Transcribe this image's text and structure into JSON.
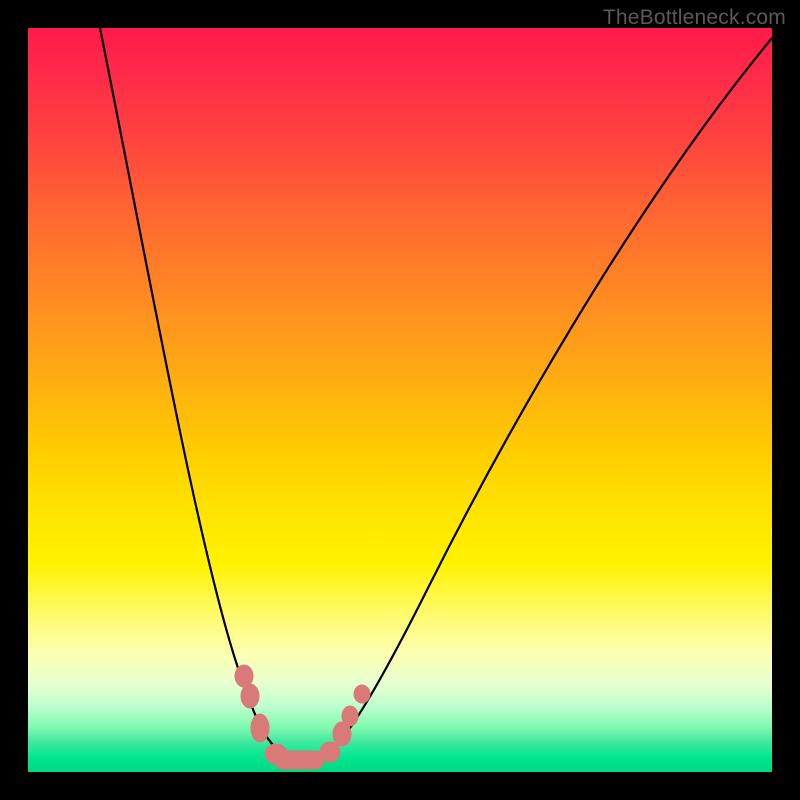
{
  "watermark": "TheBottleneck.com",
  "chart_data": {
    "type": "line",
    "title": "",
    "xlabel": "",
    "ylabel": "",
    "x_range": [
      0,
      100
    ],
    "y_range_percent_bottleneck": [
      0,
      100
    ],
    "background_gradient_meaning": "red (top) = high bottleneck, green (bottom) = no bottleneck",
    "series": [
      {
        "name": "bottleneck-curve",
        "description": "V-shaped curve; minimum near x≈36 where bottleneck ≈ 0%",
        "x": [
          10,
          15,
          20,
          25,
          28,
          31,
          33,
          35,
          37,
          39,
          41,
          44,
          50,
          60,
          75,
          95,
          100
        ],
        "y_percent": [
          100,
          77,
          55,
          34,
          20,
          10,
          4,
          1,
          0,
          1,
          4,
          10,
          24,
          45,
          68,
          94,
          99
        ]
      },
      {
        "name": "measured-points",
        "description": "pink markers clustered around curve minimum",
        "x": [
          29,
          30,
          31,
          33,
          36,
          40,
          42,
          43,
          45
        ],
        "y_percent": [
          13,
          10,
          6,
          2,
          1,
          2,
          5,
          8,
          11
        ]
      }
    ],
    "gradient_stops": [
      {
        "pos": 0.0,
        "color": "#ff1a4a"
      },
      {
        "pos": 0.3,
        "color": "#ff7a28"
      },
      {
        "pos": 0.58,
        "color": "#ffd000"
      },
      {
        "pos": 0.8,
        "color": "#fdffb0"
      },
      {
        "pos": 1.0,
        "color": "#00d880"
      }
    ]
  }
}
